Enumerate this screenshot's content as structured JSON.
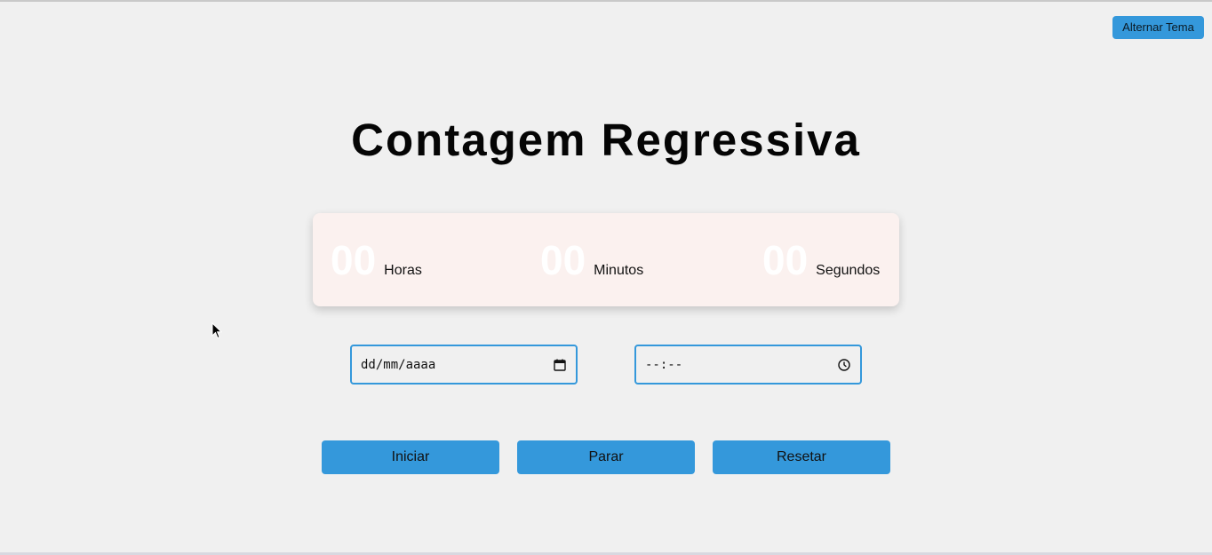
{
  "header": {
    "theme_toggle_label": "Alternar Tema"
  },
  "main": {
    "title": "Contagem Regressiva",
    "timer": {
      "hours_value": "00",
      "hours_label": "Horas",
      "minutes_value": "00",
      "minutes_label": "Minutos",
      "seconds_value": "00",
      "seconds_label": "Segundos"
    },
    "date_input": {
      "placeholder": "dd/mm/aaaa",
      "icon": "calendar-icon"
    },
    "time_input": {
      "placeholder": "--:--",
      "icon": "clock-icon"
    },
    "buttons": {
      "start_label": "Iniciar",
      "stop_label": "Parar",
      "reset_label": "Resetar"
    }
  },
  "colors": {
    "accent": "#3498db",
    "background": "#f0f0f0",
    "timer_background": "#fbf1ef"
  }
}
